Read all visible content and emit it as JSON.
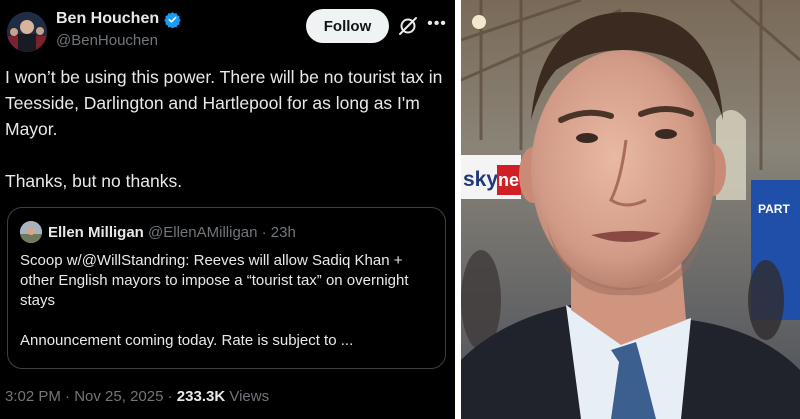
{
  "author": {
    "display_name": "Ben Houchen",
    "handle": "@BenHouchen",
    "verified_color": "#1d9bf0"
  },
  "actions": {
    "follow_label": "Follow",
    "grok_icon": "grok-icon",
    "more_icon": "more-icon"
  },
  "tweet": {
    "text": "I won’t be using this power. There will be no tourist tax in Teesside, Darlington and Hartlepool for as long as I'm Mayor.\n\nThanks, but no thanks.",
    "time": "3:02 PM",
    "sep1": " · ",
    "date": "Nov 25, 2025",
    "sep2": " · ",
    "views": "233.3K",
    "views_label": " Views"
  },
  "quote": {
    "display_name": "Ellen Milligan",
    "handle_time": " @EllenAMilligan · 23h",
    "text": "Scoop w/@WillStandring: Reeves will allow Sadiq Khan + other English mayors to impose a “tourist tax” on overnight stays\n\nAnnouncement coming today. Rate is subject to ..."
  },
  "photo": {
    "sign_text": "sky",
    "sign_text_red": "new",
    "booth_text": "PART"
  }
}
